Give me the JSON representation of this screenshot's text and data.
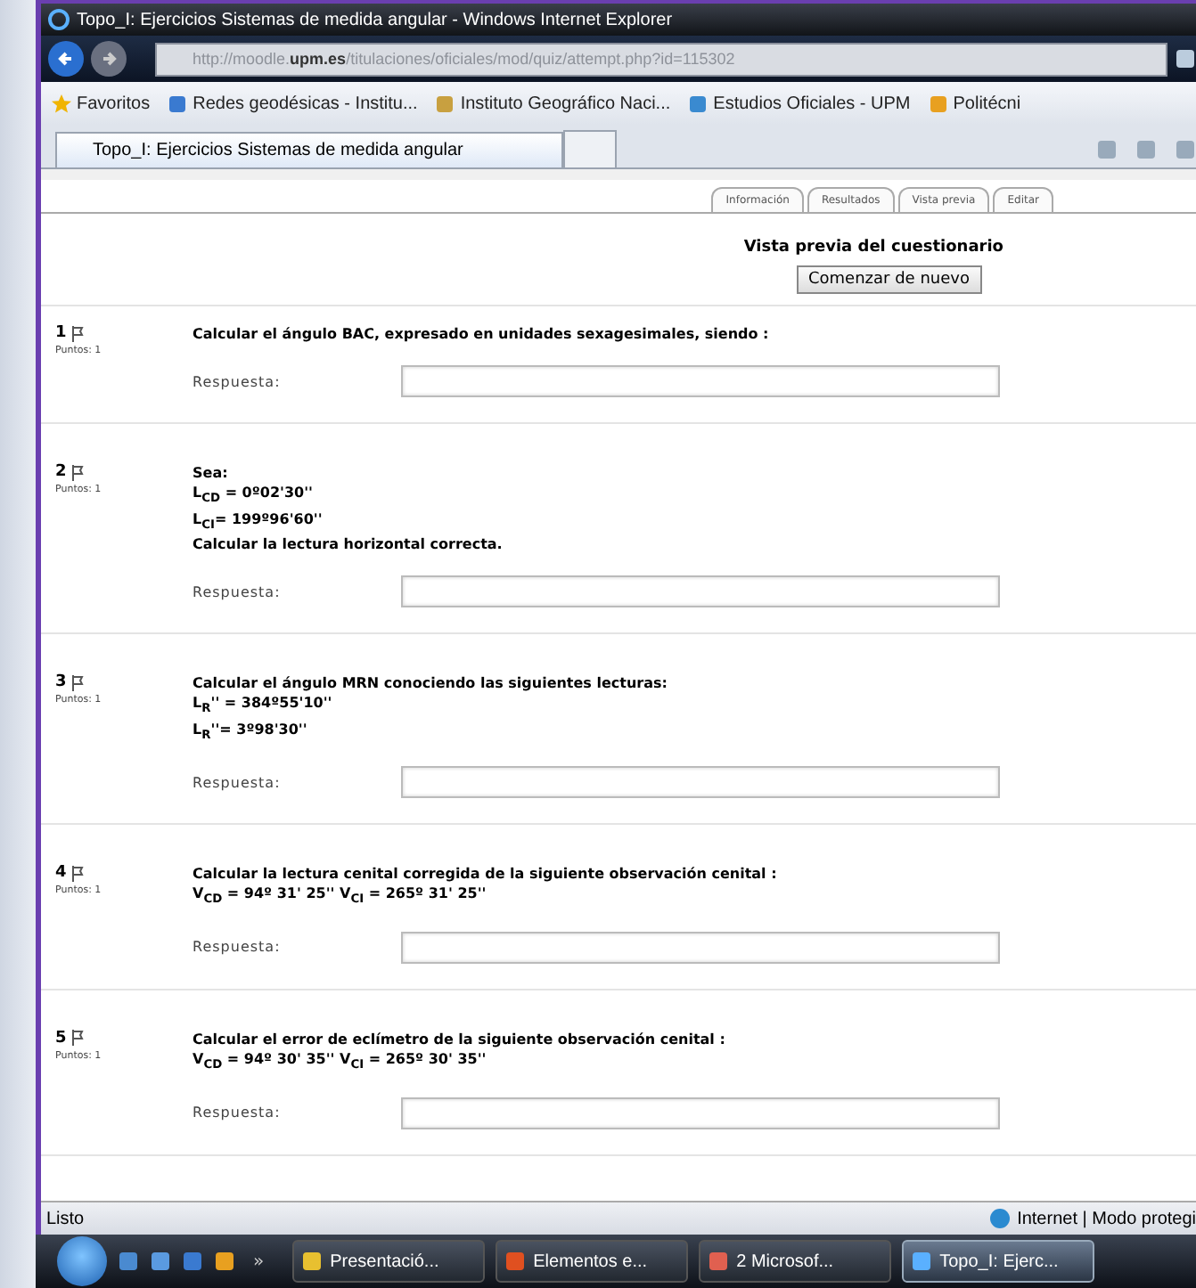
{
  "window": {
    "title": "Topo_I: Ejercicios Sistemas de medida angular - Windows Internet Explorer"
  },
  "address": {
    "url": "http://moodle.**upm.es**/titulaciones/oficiales/mod/quiz/attempt.php?id=115302"
  },
  "favorites": [
    "Favoritos",
    "Redes geodésicas - Institu...",
    "Instituto Geográfico Naci...",
    "Estudios Oficiales - UPM",
    "Politécni"
  ],
  "browser_tab": {
    "label": "Topo_I: Ejercicios Sistemas de medida angular"
  },
  "quiz_tabs": [
    "Información",
    "Resultados",
    "Vista previa",
    "Editar"
  ],
  "heading": "Vista previa del cuestionario",
  "restart_button": "Comenzar de nuevo",
  "questions": [
    {
      "number": "1",
      "points": "Puntos: 1",
      "lines": [
        "Calcular el ángulo BAC, expresado en unidades sexagesimales, siendo :"
      ],
      "answer_label": "Respuesta:"
    },
    {
      "number": "2",
      "points": "Puntos: 1",
      "lines": [
        "Sea:",
        "L$_{CD}$ = 0º02'30''",
        "L$_{CI}$= 199º96'60''",
        "Calcular la lectura horizontal correcta."
      ],
      "answer_label": "Respuesta:"
    },
    {
      "number": "3",
      "points": "Puntos: 1",
      "lines": [
        "Calcular el ángulo MRN conociendo las siguientes lecturas:",
        " L$_{R}$'' = 384º55'10''",
        "L$_{R}$''= 3º98'30''"
      ],
      "answer_label": "Respuesta:"
    },
    {
      "number": "4",
      "points": "Puntos: 1",
      "lines": [
        "Calcular la lectura cenital corregida de la siguiente observación cenital :",
        "V$_{CD}$ = 94º 31' 25'' V$_{CI}$ = 265º 31' 25''"
      ],
      "answer_label": "Respuesta:"
    },
    {
      "number": "5",
      "points": "Puntos: 1",
      "lines": [
        "Calcular el error de eclímetro de la siguiente observación cenital :",
        "V$_{CD}$ = 94º 30' 35'' V$_{CI}$ = 265º 30' 35''"
      ],
      "answer_label": "Respuesta:"
    }
  ],
  "status_bar": {
    "text": "Listo",
    "zone": "Internet | Modo protegi"
  },
  "taskbar": {
    "overflow": "»",
    "tasks": [
      {
        "label": "Presentació...",
        "selected": false
      },
      {
        "label": "Elementos e...",
        "selected": false
      },
      {
        "label": "2 Microsof...",
        "selected": false
      },
      {
        "label": "Topo_I: Ejerc...",
        "selected": true
      }
    ]
  }
}
